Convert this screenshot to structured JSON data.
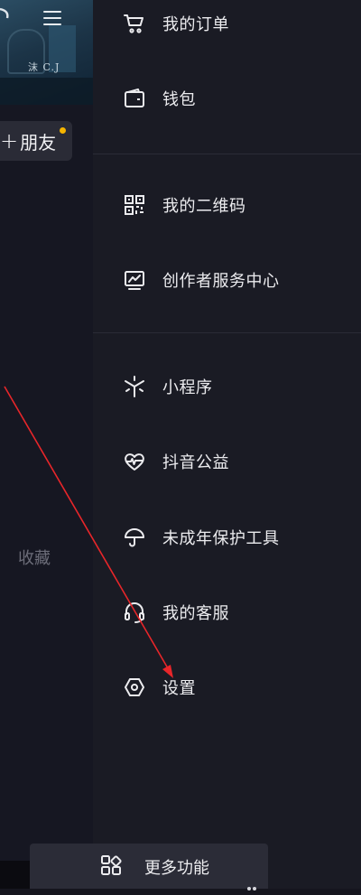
{
  "left_panel": {
    "banner_logo_text": "沫 C.J",
    "add_friend_label": "朋友",
    "add_friend_plus": "+",
    "favorites_label": "收藏"
  },
  "drawer": {
    "items": [
      {
        "label": "我的订单",
        "icon": "cart-icon"
      },
      {
        "label": "钱包",
        "icon": "wallet-icon"
      },
      {
        "label": "我的二维码",
        "icon": "qr-code-icon"
      },
      {
        "label": "创作者服务中心",
        "icon": "creator-chart-icon"
      },
      {
        "label": "小程序",
        "icon": "mini-program-icon"
      },
      {
        "label": "抖音公益",
        "icon": "charity-heart-icon"
      },
      {
        "label": "未成年保护工具",
        "icon": "umbrella-icon"
      },
      {
        "label": "我的客服",
        "icon": "headset-icon"
      },
      {
        "label": "设置",
        "icon": "settings-hexagon-icon"
      }
    ],
    "more_label": "更多功能"
  },
  "colors": {
    "background": "#15151e",
    "drawer": "#1a1b24",
    "annotation_arrow": "#e8262a",
    "notify_dot": "#f5b400"
  }
}
